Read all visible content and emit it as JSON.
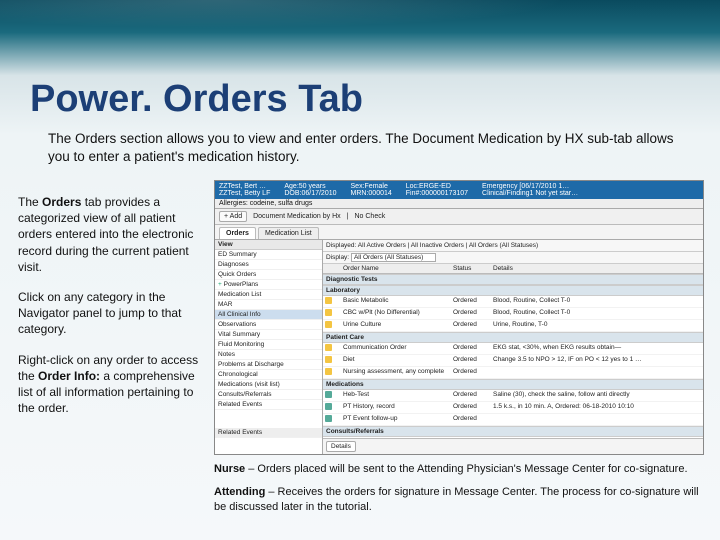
{
  "title": "Power. Orders Tab",
  "subtitle": "The Orders section allows you to view and enter orders.  The Document Medication by HX sub-tab allows you to enter a patient's medication history.",
  "left": {
    "p1a": "The ",
    "p1b": "Orders",
    "p1c": " tab provides a categorized view of all patient orders entered into the electronic record during the current patient visit.",
    "p2": "Click on any category in the Navigator panel to jump to that category.",
    "p3a": "Right-click on any order to access the ",
    "p3b": "Order Info:",
    "p3c": " a comprehensive list of all information pertaining to the order."
  },
  "footer": {
    "n1a": "Nurse",
    "n1b": " – Orders placed will be sent to the Attending Physician's Message Center for co-signature.",
    "n2a": "Attending",
    "n2b": " – Receives the orders for signature in Message Center.  The process for co-signature will be discussed later in the tutorial."
  },
  "pt": {
    "name": "ZZTest, Bert …",
    "name2": "ZZTest, Betty LF",
    "age_lbl": "Age:50 years",
    "dob": "DOB:06/17/2010",
    "sex": "Sex:Female",
    "mrn": "MRN:000014",
    "loc": "Loc:ERGE-ED",
    "fin": "Fin#:000000173107",
    "emerg": "Emergency [06/17/2010 1…",
    "clin": "Clinical/Finding1 Not yet star…"
  },
  "allergy": "Allergies: codeine, sulfa drugs",
  "tabs": {
    "orders": "Orders",
    "docmed": "Document Medication by Hx",
    "nocheck": "No Check"
  },
  "toolbar": {
    "add": "+ Add",
    "pwrplans": "PowerPlans"
  },
  "nav": {
    "head": "View",
    "items": [
      "ED Summary",
      "Diagnoses",
      "Quick Orders",
      "Medication List",
      "MAR",
      "All Clinical Info",
      "Observations",
      "Vital Summary",
      "Fluid Monitoring",
      "Notes",
      "Problems at Discharge",
      "Chronological",
      "Medications (visit list)",
      "Consults/Referrals",
      "Related Events"
    ]
  },
  "panel": {
    "display": "Displayed: All Active Orders | All Inactive Orders | All Orders (All Statuses)",
    "filter_lbl": "Display:",
    "filter_val": "All Orders (All Statuses)",
    "cols": {
      "c1": "",
      "c2": "Order Name",
      "c3": "Status",
      "c4": "Details"
    },
    "cats": {
      "diag": "Diagnostic Tests",
      "lab": "Laboratory",
      "pc": "Patient Care",
      "med": "Medications",
      "cons": "Consults/Referrals"
    },
    "rows": [
      {
        "cat": "lab",
        "name": "Basic Metabolic",
        "status": "Ordered",
        "details": "Blood, Routine, Collect T-0"
      },
      {
        "cat": "lab",
        "name": "CBC w/Plt (No Differential)",
        "status": "Ordered",
        "details": "Blood, Routine, Collect T-0"
      },
      {
        "cat": "lab",
        "name": "Urine Culture",
        "status": "Ordered",
        "details": "Urine, Routine, T-0"
      },
      {
        "cat": "pc",
        "name": "Communication Order",
        "status": "Ordered",
        "details": "EKG stat, <30%, when EKG results obtain—"
      },
      {
        "cat": "pc",
        "name": "Diet",
        "status": "Ordered",
        "details": "Change 3.5 to NPO > 12, IF on PO < 12 yes to 1 …"
      },
      {
        "cat": "pc",
        "name": "Nursing assessment, any complete",
        "status": "Ordered",
        "details": ""
      },
      {
        "cat": "med",
        "name": "Heb-Test",
        "status": "Ordered",
        "details": "Saline (30), check the saline, follow anti directly"
      },
      {
        "cat": "med",
        "name": "PT History, record",
        "status": "Ordered",
        "details": "1.5 k.s., in 10 min. A, Ordered: 06-18-2010 10:10"
      },
      {
        "cat": "med",
        "name": "PT Event follow-up",
        "status": "Ordered",
        "details": ""
      }
    ]
  },
  "buttons": {
    "related": "Related Events",
    "details": "Details"
  }
}
